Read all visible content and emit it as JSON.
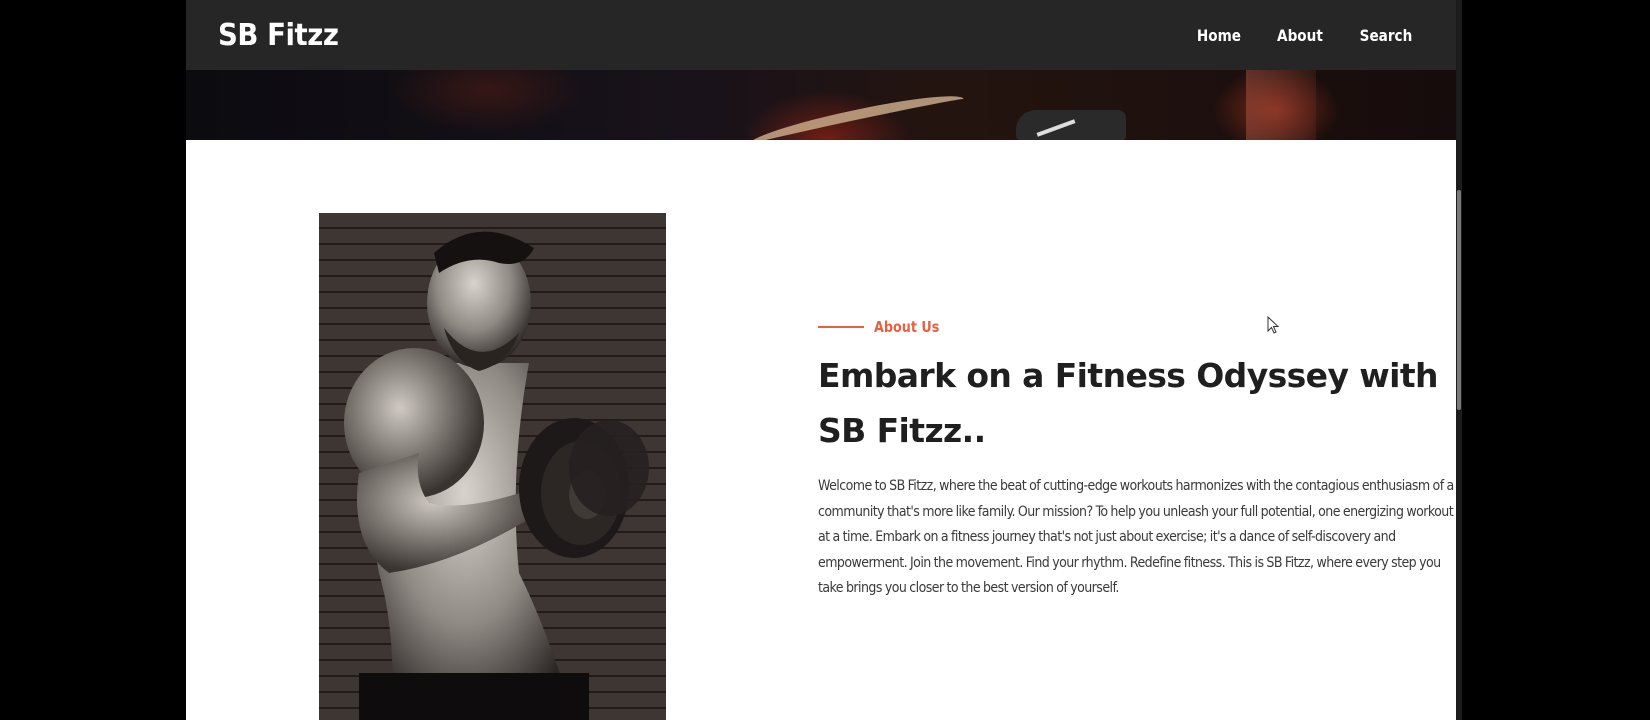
{
  "navbar": {
    "brand": "SB Fitzz",
    "links": [
      {
        "label": "Home"
      },
      {
        "label": "About"
      },
      {
        "label": "Search"
      }
    ]
  },
  "about": {
    "label": "About Us",
    "heading": "Embark on a Fitness Odyssey with SB Fitzz..",
    "body": "Welcome to SB Fitzz, where the beat of cutting-edge workouts harmonizes with the contagious enthusiasm of a community that's more like family. Our mission? To help you unleash your full potential, one energizing workout at a time. Embark on a fitness journey that's not just about exercise; it's a dance of self-discovery and empowerment. Join the movement. Find your rhythm. Redefine fitness. This is SB Fitzz, where every step you take brings you closer to the best version of yourself."
  },
  "colors": {
    "navbar_bg": "#262626",
    "accent": "#e8603e",
    "photo_accent": "#f04e37",
    "heading": "#1f1f1f",
    "body_text": "#3a3a3a"
  },
  "icons": {
    "cursor": "mouse-pointer-icon"
  }
}
